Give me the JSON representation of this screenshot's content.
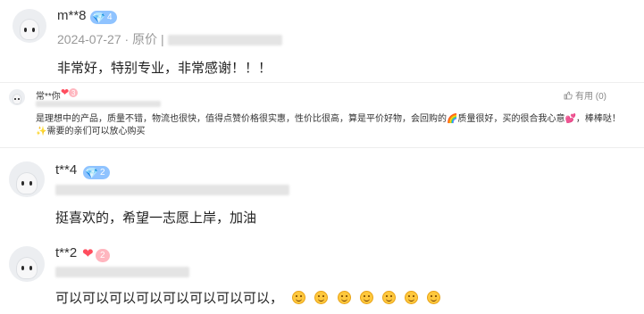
{
  "reviews": [
    {
      "username": "m**8",
      "badge_level": "4",
      "badge_type": "diamond",
      "date": "2024-07-27",
      "price_label": "原价",
      "content": "非常好，特别专业，非常感谢！！！"
    },
    {
      "username": "常**你",
      "badge_level": "3",
      "badge_type": "heart",
      "helpful_label": "有用 (0)",
      "content": "是理想中的产品，质量不错，物流也很快，值得点赞价格很实惠，性价比很高，算是平价好物，会回购的🌈质量很好，买的很合我心意💕，棒棒哒！✨需要的亲们可以放心购买"
    },
    {
      "username": "t**4",
      "badge_level": "2",
      "badge_type": "diamond",
      "content": "挺喜欢的，希望一志愿上岸，加油"
    },
    {
      "username": "t**2",
      "badge_level": "2",
      "badge_type": "heart",
      "content": "可以可以可以可以可以可以可以可以，"
    }
  ],
  "colors": {
    "diamond_badge": "#8fc3ff",
    "heart_badge": "#ffb6bf",
    "heart": "#ff4d5e",
    "diamond": "#3a9cff"
  }
}
